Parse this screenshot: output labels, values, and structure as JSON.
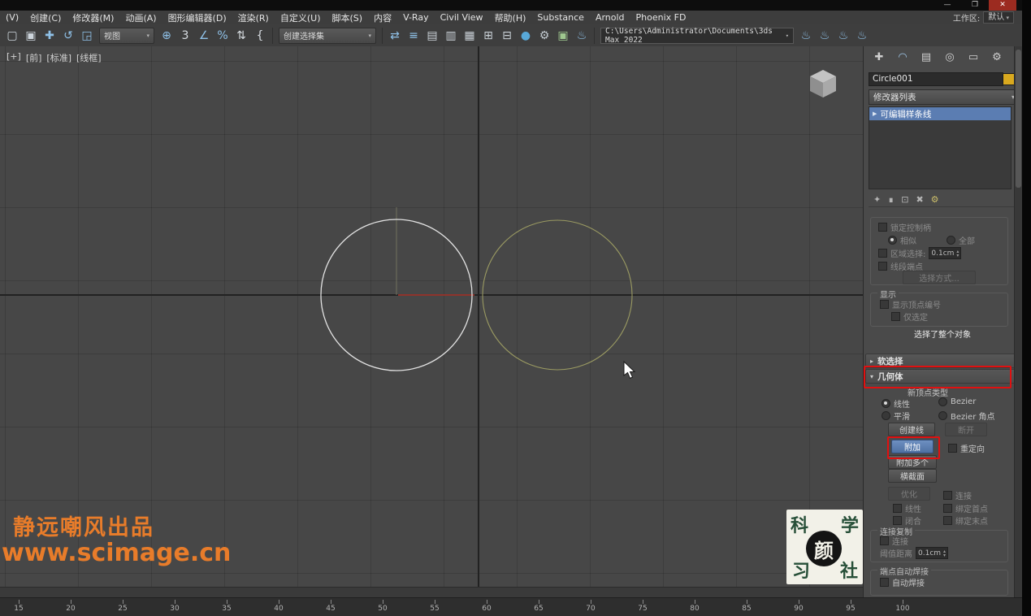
{
  "titlebar": {
    "minimize": "—",
    "maximize": "❐",
    "close": "✕"
  },
  "menubar": {
    "items": [
      "(V)",
      "创建(C)",
      "修改器(M)",
      "动画(A)",
      "图形编辑器(D)",
      "渲染(R)",
      "自定义(U)",
      "脚本(S)",
      "内容",
      "V-Ray",
      "Civil View",
      "帮助(H)",
      "Substance",
      "Arnold",
      "Phoenix FD"
    ],
    "workspace_label": "工作区:",
    "workspace_value": "默认"
  },
  "toolbar": {
    "icons_a": [
      {
        "n": "select-region-rect-icon",
        "g": "▢",
        "c": "#cdd5dc"
      },
      {
        "n": "select-region-window-icon",
        "g": "▣",
        "c": "#cdd5dc"
      },
      {
        "n": "select-and-move-icon",
        "g": "✚",
        "c": "#8fc1e8"
      },
      {
        "n": "select-and-rotate-icon",
        "g": "↺",
        "c": "#8fc1e8"
      },
      {
        "n": "select-and-scale-icon",
        "g": "◲",
        "c": "#8fc1e8"
      }
    ],
    "view_dropdown": "视图",
    "icons_b": [
      {
        "n": "use-pivot-point-icon",
        "g": "⊕",
        "c": "#8fc1e8"
      },
      {
        "n": "snap-toggle-3d-icon",
        "g": "3",
        "c": "#d8dde2"
      },
      {
        "n": "angle-snap-icon",
        "g": "∠",
        "c": "#8fc1e8"
      },
      {
        "n": "percent-snap-icon",
        "g": "%",
        "c": "#8fc1e8"
      },
      {
        "n": "spinner-snap-icon",
        "g": "⇅",
        "c": "#d8dde2"
      },
      {
        "n": "named-selection-sets-icon",
        "g": "{",
        "c": "#d8dde2"
      }
    ],
    "selection_set_label": "创建选择集",
    "icons_c": [
      {
        "n": "mirror-icon",
        "g": "⇄",
        "c": "#8fc1e8"
      },
      {
        "n": "align-icon",
        "g": "≡",
        "c": "#8fc1e8"
      },
      {
        "n": "scene-explorer-icon",
        "g": "▤",
        "c": "#c9d0d6"
      },
      {
        "n": "layer-explorer-icon",
        "g": "▥",
        "c": "#c9d0d6"
      },
      {
        "n": "ribbon-toggle-icon",
        "g": "▦",
        "c": "#c9d0d6"
      },
      {
        "n": "curve-editor-icon",
        "g": "⊞",
        "c": "#c9d0d6"
      },
      {
        "n": "schematic-view-icon",
        "g": "⊟",
        "c": "#c9d0d6"
      },
      {
        "n": "material-editor-icon",
        "g": "●",
        "c": "#58a8d8"
      },
      {
        "n": "render-setup-icon",
        "g": "⚙",
        "c": "#c2cad0"
      },
      {
        "n": "rendered-frame-window-icon",
        "g": "▣",
        "c": "#9fc78f"
      },
      {
        "n": "render-production-icon",
        "g": "♨",
        "c": "#8fc1e8"
      }
    ],
    "project_path": "C:\\Users\\Administrator\\Documents\\3ds Max 2022",
    "icons_d": [
      {
        "n": "render-preset-1-icon",
        "g": "♨",
        "c": "#8fc1e8"
      },
      {
        "n": "render-preset-2-icon",
        "g": "♨",
        "c": "#8fc1e8"
      },
      {
        "n": "render-preset-3-icon",
        "g": "♨",
        "c": "#8fc1e8"
      },
      {
        "n": "render-preset-4-icon",
        "g": "♨",
        "c": "#8fc1e8"
      }
    ]
  },
  "viewport": {
    "label_maximize": "[+]",
    "label_view": "[前]",
    "label_vis": "[标准]",
    "label_shading": "[线框]"
  },
  "scene": {
    "circle_selected": {
      "cx": "488",
      "cy": "306",
      "r": "93"
    },
    "circle_second": {
      "cx": "686",
      "cy": "306",
      "r": "92"
    }
  },
  "watermark": {
    "line1": "静远嘲风出品",
    "line2": "www.scimage.cn"
  },
  "logo": {
    "tl": "科",
    "tr": "学",
    "center": "颜",
    "bl": "习",
    "br": "社"
  },
  "panel": {
    "tabs": [
      {
        "n": "tab-create-icon",
        "g": "✚",
        "c": "#cfcfcf"
      },
      {
        "n": "tab-modify-icon",
        "g": "◠",
        "c": "#9fc7e8"
      },
      {
        "n": "tab-hierarchy-icon",
        "g": "▤",
        "c": "#cfcfcf"
      },
      {
        "n": "tab-motion-icon",
        "g": "◎",
        "c": "#cfcfcf"
      },
      {
        "n": "tab-display-icon",
        "g": "▭",
        "c": "#cfcfcf"
      },
      {
        "n": "tab-utilities-icon",
        "g": "⚙",
        "c": "#cfcfcf"
      }
    ],
    "object_name": "Circle001",
    "object_color": "#d9a91f",
    "modifier_list_label": "修改器列表",
    "stack_item": "可编辑样条线",
    "stack_tools": [
      {
        "n": "pin-stack-icon",
        "g": "✦",
        "c": "#b5b5b5"
      },
      {
        "n": "show-end-result-icon",
        "g": "∎",
        "c": "#b5b5b5"
      },
      {
        "n": "make-unique-icon",
        "g": "⊡",
        "c": "#b5b5b5"
      },
      {
        "n": "remove-modifier-icon",
        "g": "✖",
        "c": "#b5b5b5"
      },
      {
        "n": "configure-modifier-sets-icon",
        "g": "⚙",
        "c": "#cbbd6a"
      }
    ],
    "selection": {
      "lock_handles": "锁定控制柄",
      "alike": "相似",
      "all": "全部",
      "area_selection": "区域选择:",
      "area_value": "0.1cm",
      "segment_end": "线段端点",
      "select_by_btn": "选择方式...",
      "display_group": "显示",
      "show_vertex_numbers": "显示顶点编号",
      "selected_only": "仅选定",
      "status": "选择了整个对象"
    },
    "rollouts": {
      "soft_selection": "软选择",
      "geometry": "几何体"
    },
    "geometry": {
      "new_vertex_type": "新顶点类型",
      "linear": "线性",
      "bezier": "Bezier",
      "smooth": "平滑",
      "bezier_corner": "Bezier 角点",
      "create_line": "创建线",
      "break_btn": "断开",
      "attach": "附加",
      "reorient": "重定向",
      "attach_mult": "附加多个",
      "cross_section": "横截面",
      "refine": "优化",
      "connect": "连接",
      "linear2": "线性",
      "bind_first": "绑定首点",
      "closed": "闭合",
      "bind_last": "绑定末点",
      "connect_copy_group": "连接复制",
      "connect_cb": "连接",
      "threshold_label": "阈值距离",
      "threshold_value": "0.1cm",
      "weld_group": "端点自动焊接",
      "auto_weld": "自动焊接"
    }
  },
  "ruler": {
    "labels": [
      "15",
      "20",
      "25",
      "30",
      "35",
      "40",
      "45",
      "50",
      "55",
      "60",
      "65",
      "70",
      "75",
      "80",
      "85",
      "90",
      "95",
      "100"
    ]
  }
}
